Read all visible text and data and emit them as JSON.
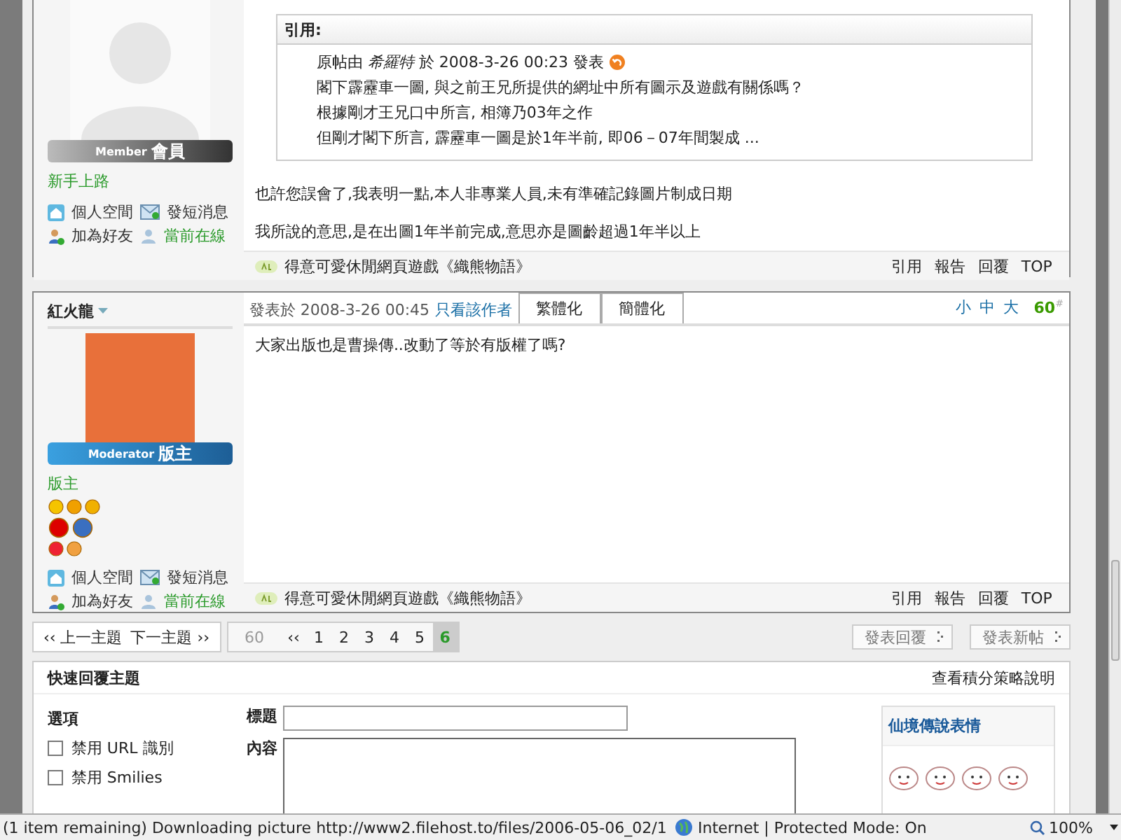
{
  "posts": [
    {
      "kind": "member",
      "role_en": "Member",
      "role": "會員",
      "rank": "新手上路",
      "actions": [
        {
          "label": "個人空間",
          "online": false
        },
        {
          "label": "發短消息",
          "online": false
        },
        {
          "label": "加為好友",
          "online": false
        },
        {
          "label": "當前在線",
          "online": true
        }
      ],
      "quote": {
        "label": "引用:",
        "header": "原帖由 *希羅特* 於 2008-3-26 00:23 發表",
        "lines": [
          "閣下霹靂車一圖, 與之前王兄所提供的網址中所有圖示及遊戲有關係嗎？",
          "根據剛才王兄口中所言, 相簿乃03年之作",
          "但剛才閣下所言, 霹靂車一圖是於1年半前, 即06－07年間製成 ..."
        ]
      },
      "body": [
        "也許您誤會了,我表明一點,本人非專業人員,未有準確記錄圖片制成日期",
        "我所說的意思,是在出圖1年半前完成,意思亦是圖齡超過1年半以上"
      ],
      "ad": "得意可愛休閒網頁遊戲《織熊物語》",
      "links": [
        "引用",
        "報告",
        "回覆",
        "TOP"
      ]
    },
    {
      "kind": "moderator",
      "author": "紅火龍",
      "role_en": "Moderator",
      "role": "版主",
      "rank": "版主",
      "actions": [
        {
          "label": "個人空間",
          "online": false
        },
        {
          "label": "發短消息",
          "online": false
        },
        {
          "label": "加為好友",
          "online": false
        },
        {
          "label": "當前在線",
          "online": true
        }
      ],
      "meta": "發表於 2008-3-26 00:45",
      "author_only": "只看該作者",
      "tabs": [
        "繁體化",
        "簡體化"
      ],
      "sizes": [
        "小",
        "中",
        "大"
      ],
      "floor": "60",
      "floor_mark": "#",
      "body": [
        "大家出版也是曹操傳..改動了等於有版權了嗎?"
      ],
      "ad": "得意可愛休閒網頁遊戲《織熊物語》",
      "links": [
        "引用",
        "報告",
        "回覆",
        "TOP"
      ]
    }
  ],
  "topic_nav": [
    "‹‹ 上一主題",
    "下一主題 ››"
  ],
  "pagination": {
    "total": "60",
    "first": "‹‹",
    "pages": [
      {
        "label": "1",
        "selected": false
      },
      {
        "label": "2",
        "selected": false
      },
      {
        "label": "3",
        "selected": false
      },
      {
        "label": "4",
        "selected": false
      },
      {
        "label": "5",
        "selected": false
      },
      {
        "label": "6",
        "selected": true
      }
    ]
  },
  "post_buttons": [
    "發表回覆",
    "發表新帖"
  ],
  "quick_reply": {
    "title": "快速回覆主題",
    "rules_link": "查看積分策略說明",
    "options_title": "選項",
    "options": [
      {
        "label": "禁用 URL 識別",
        "checked": false
      },
      {
        "label": "禁用 Smilies",
        "checked": false
      }
    ],
    "subject_label": "標題",
    "content_label": "內容",
    "smilies_title": "仙境傳說表情"
  },
  "status_bar": {
    "message": "(1 item remaining) Downloading picture http://www2.filehost.to/files/2006-05-06_02/1",
    "zone": "Internet | Protected Mode: On",
    "zoom": "100%"
  }
}
